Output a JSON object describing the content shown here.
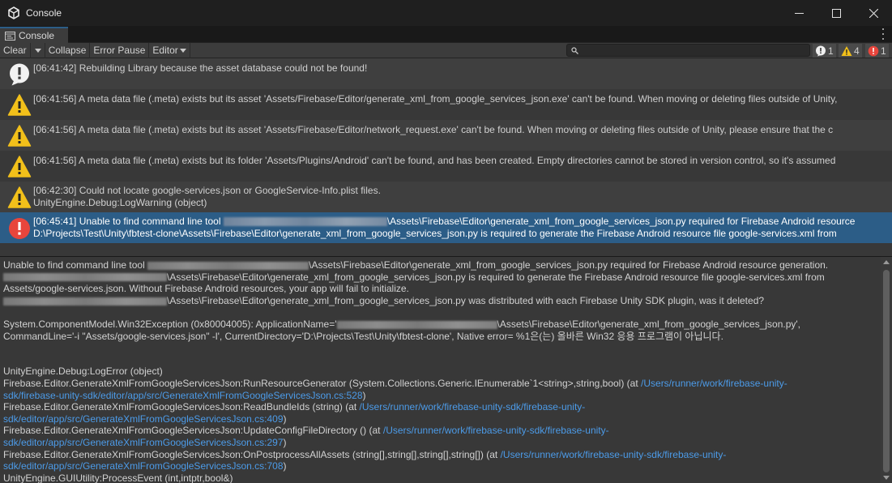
{
  "window": {
    "title": "Console"
  },
  "tab": {
    "label": "Console"
  },
  "toolbar": {
    "clear": "Clear",
    "collapse": "Collapse",
    "error_pause": "Error Pause",
    "editor": "Editor",
    "search_value": "",
    "counts": {
      "info": "1",
      "warning": "4",
      "error": "1"
    }
  },
  "colors": {
    "selection": "#2c5d87",
    "warning": "#f2c01a",
    "error": "#e8453c",
    "link": "#4c9be8"
  },
  "logs": [
    {
      "type": "info",
      "icon": "info-icon",
      "line1": "[06:41:42] Rebuilding Library because the asset database could not be found!",
      "line2": ""
    },
    {
      "type": "warning",
      "icon": "warning-icon",
      "line1": "[06:41:56] A meta data file (.meta) exists but its asset 'Assets/Firebase/Editor/generate_xml_from_google_services_json.exe' can't be found. When moving or deleting files outside of Unity,",
      "line2": ""
    },
    {
      "type": "warning",
      "icon": "warning-icon",
      "line1": "[06:41:56] A meta data file (.meta) exists but its asset 'Assets/Firebase/Editor/network_request.exe' can't be found. When moving or deleting files outside of Unity, please ensure that the c",
      "line2": ""
    },
    {
      "type": "warning",
      "icon": "warning-icon",
      "line1": "[06:41:56] A meta data file (.meta) exists but its folder 'Assets/Plugins/Android' can't be found, and has been created. Empty directories cannot be stored in version control, so it's assumed",
      "line2": ""
    },
    {
      "type": "warning",
      "icon": "warning-icon",
      "line1": "[06:42:30] Could not locate google-services.json or GoogleService-Info.plist files.",
      "line2": "UnityEngine.Debug:LogWarning (object)"
    },
    {
      "type": "error",
      "icon": "error-icon",
      "line1_pre": "[06:45:41] Unable to find command line tool ",
      "line1_post": "\\Assets\\Firebase\\Editor\\generate_xml_from_google_services_json.py required for Firebase Android resource",
      "line2": "D:\\Projects\\Test\\Unity\\fbtest-clone\\Assets\\Firebase\\Editor\\generate_xml_from_google_services_json.py is required to generate the Firebase Android resource file google-services.xml from"
    }
  ],
  "details": {
    "l1_pre": "Unable to find command line tool ",
    "l1_post": "\\Assets\\Firebase\\Editor\\generate_xml_from_google_services_json.py required for Firebase Android resource generation.",
    "l2_post": "\\Assets\\Firebase\\Editor\\generate_xml_from_google_services_json.py is required to generate the Firebase Android resource file google-services.xml from",
    "l3": "Assets/google-services.json. Without Firebase Android resources, your app will fail to initialize.",
    "l4_post": "\\Assets\\Firebase\\Editor\\generate_xml_from_google_services_json.py was distributed with each Firebase Unity SDK plugin, was it deleted?",
    "l5_pre": "System.ComponentModel.Win32Exception (0x80004005): ApplicationName='",
    "l5_post": "\\Assets\\Firebase\\Editor\\generate_xml_from_google_services_json.py',",
    "l6": "CommandLine='-i \"Assets/google-services.json\" -l', CurrentDirectory='D:\\Projects\\Test\\Unity\\fbtest-clone', Native error= %1은(는) 올바른 Win32 응용 프로그램이 아닙니다.",
    "l7": "UnityEngine.Debug:LogError (object)",
    "l8_pre": "Firebase.Editor.GenerateXmlFromGoogleServicesJson:RunResourceGenerator (System.Collections.Generic.IEnumerable`1<string>,string,bool) (at ",
    "l8_link": "/Users/runner/work/firebase-unity-",
    "l9_link": "sdk/firebase-unity-sdk/editor/app/src/GenerateXmlFromGoogleServicesJson.cs:528",
    "l9_post": ")",
    "l10_pre": "Firebase.Editor.GenerateXmlFromGoogleServicesJson:ReadBundleIds (string) (at ",
    "l10_link": "/Users/runner/work/firebase-unity-sdk/firebase-unity-",
    "l11_link": "sdk/editor/app/src/GenerateXmlFromGoogleServicesJson.cs:409",
    "l11_post": ")",
    "l12_pre": "Firebase.Editor.GenerateXmlFromGoogleServicesJson:UpdateConfigFileDirectory () (at ",
    "l12_link": "/Users/runner/work/firebase-unity-sdk/firebase-unity-",
    "l13_link": "sdk/editor/app/src/GenerateXmlFromGoogleServicesJson.cs:297",
    "l13_post": ")",
    "l14_pre": "Firebase.Editor.GenerateXmlFromGoogleServicesJson:OnPostprocessAllAssets (string[],string[],string[],string[]) (at ",
    "l14_link": "/Users/runner/work/firebase-unity-sdk/firebase-unity-",
    "l15_link": "sdk/editor/app/src/GenerateXmlFromGoogleServicesJson.cs:708",
    "l15_post": ")",
    "l16": "UnityEngine.GUIUtility:ProcessEvent (int,intptr,bool&)"
  }
}
